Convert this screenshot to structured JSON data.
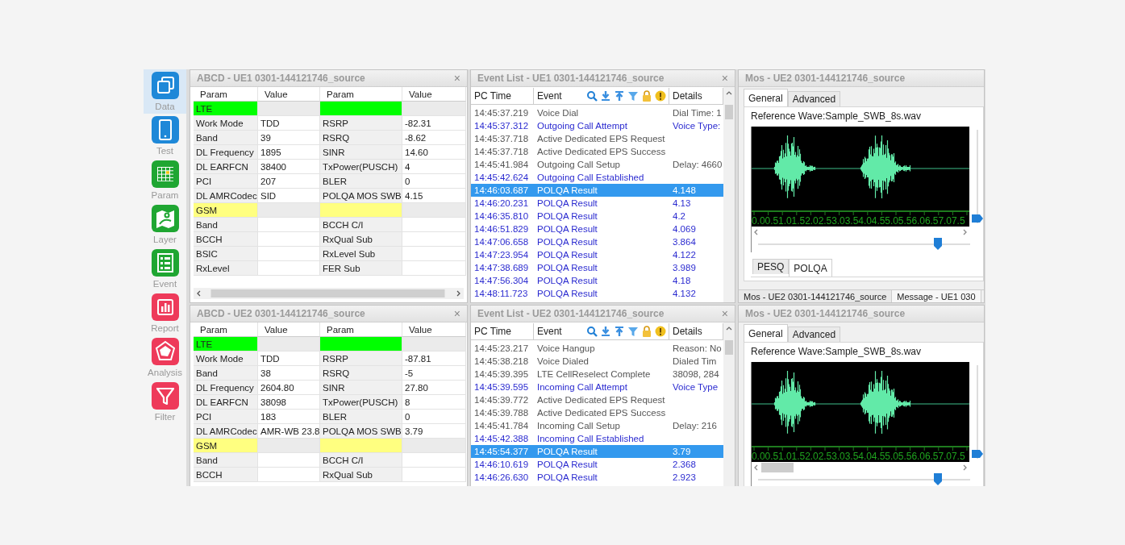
{
  "sidebar": {
    "items": [
      {
        "label": "Data",
        "selected": true,
        "color": "#1e88d8"
      },
      {
        "label": "Test",
        "selected": false,
        "color": "#1e88d8"
      },
      {
        "label": "Param",
        "selected": false,
        "color": "#1fa632"
      },
      {
        "label": "Layer",
        "selected": false,
        "color": "#1fa632"
      },
      {
        "label": "Event",
        "selected": false,
        "color": "#1fa632"
      },
      {
        "label": "Report",
        "selected": false,
        "color": "#ee3a5a"
      },
      {
        "label": "Analysis",
        "selected": false,
        "color": "#ee3a5a"
      },
      {
        "label": "Filter",
        "selected": false,
        "color": "#ee3a5a"
      }
    ]
  },
  "param_panels": [
    {
      "title": "ABCD - UE1 0301-144121746_source",
      "close": "×",
      "columns": [
        "Param",
        "Value",
        "Param",
        "Value"
      ],
      "horizontal_scrollbar": true,
      "rows": [
        {
          "kind": "section",
          "label": "LTE",
          "color": "#00ff00"
        },
        {
          "kind": "data",
          "param": "Work Mode",
          "value": "TDD",
          "param_2": "RSRP",
          "value_2": "-82.31"
        },
        {
          "kind": "data",
          "param": "Band",
          "value": "39",
          "param_2": "RSRQ",
          "value_2": "-8.62"
        },
        {
          "kind": "data",
          "param": "DL Frequency",
          "value": "1895",
          "param_2": "SINR",
          "value_2": "14.60"
        },
        {
          "kind": "data",
          "param": "DL EARFCN",
          "value": "38400",
          "param_2": "TxPower(PUSCH)",
          "value_2": "4"
        },
        {
          "kind": "data",
          "param": "PCI",
          "value": "207",
          "param_2": "BLER",
          "value_2": "0"
        },
        {
          "kind": "data",
          "param": "DL AMRCodec",
          "value": "SID",
          "param_2": "POLQA MOS SWB",
          "value_2": "4.15"
        },
        {
          "kind": "section",
          "label": "GSM",
          "color": "#ffff80"
        },
        {
          "kind": "data",
          "param": "Band",
          "param_2": "BCCH C/I"
        },
        {
          "kind": "data",
          "param": "BCCH",
          "param_2": "RxQual Sub"
        },
        {
          "kind": "data",
          "param": "BSIC",
          "param_2": "RxLevel Sub"
        },
        {
          "kind": "data",
          "param": "RxLevel",
          "param_2": "FER Sub"
        }
      ]
    },
    {
      "title": "ABCD - UE2 0301-144121746_source",
      "close": "×",
      "columns": [
        "Param",
        "Value",
        "Param",
        "Value"
      ],
      "rows": [
        {
          "kind": "section",
          "label": "LTE",
          "color": "#00ff00"
        },
        {
          "kind": "data",
          "param": "Work Mode",
          "value": "TDD",
          "param_2": "RSRP",
          "value_2": "-87.81"
        },
        {
          "kind": "data",
          "param": "Band",
          "value": "38",
          "param_2": "RSRQ",
          "value_2": "-5"
        },
        {
          "kind": "data",
          "param": "DL Frequency",
          "value": "2604.80",
          "param_2": "SINR",
          "value_2": "27.80"
        },
        {
          "kind": "data",
          "param": "DL EARFCN",
          "value": "38098",
          "param_2": "TxPower(PUSCH)",
          "value_2": "8"
        },
        {
          "kind": "data",
          "param": "PCI",
          "value": "183",
          "param_2": "BLER",
          "value_2": "0"
        },
        {
          "kind": "data",
          "param": "DL AMRCodec",
          "value": "AMR-WB 23.8",
          "param_2": "POLQA MOS SWB",
          "value_2": "3.79"
        },
        {
          "kind": "section",
          "label": "GSM",
          "color": "#ffff80"
        },
        {
          "kind": "data",
          "param": "Band",
          "param_2": "BCCH C/I"
        },
        {
          "kind": "data",
          "param": "BCCH",
          "param_2": "RxQual Sub"
        }
      ]
    }
  ],
  "event_panels": [
    {
      "title": "Event List - UE1 0301-144121746_source",
      "close": "×",
      "columns": [
        "PC Time",
        "Event",
        "Details"
      ],
      "rows": [
        {
          "time": "14:45:37.219",
          "event": "Voice Dial",
          "details": "Dial Time: 1",
          "color": "#555555",
          "selected": false
        },
        {
          "time": "14:45:37.312",
          "event": "Outgoing Call Attempt",
          "details": "Voice Type:",
          "color": "#2b2bd0",
          "selected": false
        },
        {
          "time": "14:45:37.718",
          "event": "Active Dedicated EPS Request",
          "color": "#555555",
          "selected": false
        },
        {
          "time": "14:45:37.718",
          "event": "Active Dedicated EPS Success",
          "color": "#555555",
          "selected": false
        },
        {
          "time": "14:45:41.984",
          "event": "Outgoing Call Setup",
          "details": "Delay: 4660",
          "color": "#555555",
          "selected": false
        },
        {
          "time": "14:45:42.624",
          "event": "Outgoing Call Established",
          "color": "#2b2bd0",
          "selected": false
        },
        {
          "time": "14:46:03.687",
          "event": "POLQA Result",
          "details": "4.148",
          "selected": true
        },
        {
          "time": "14:46:20.231",
          "event": "POLQA Result",
          "details": "4.13",
          "color": "#2b2bd0",
          "selected": false
        },
        {
          "time": "14:46:35.810",
          "event": "POLQA Result",
          "details": "4.2",
          "color": "#2b2bd0",
          "selected": false
        },
        {
          "time": "14:46:51.829",
          "event": "POLQA Result",
          "details": "4.069",
          "color": "#2b2bd0",
          "selected": false
        },
        {
          "time": "14:47:06.658",
          "event": "POLQA Result",
          "details": "3.864",
          "color": "#2b2bd0",
          "selected": false
        },
        {
          "time": "14:47:23.954",
          "event": "POLQA Result",
          "details": "4.122",
          "color": "#2b2bd0",
          "selected": false
        },
        {
          "time": "14:47:38.689",
          "event": "POLQA Result",
          "details": "3.989",
          "color": "#2b2bd0",
          "selected": false
        },
        {
          "time": "14:47:56.304",
          "event": "POLQA Result",
          "details": "4.18",
          "color": "#2b2bd0",
          "selected": false
        },
        {
          "time": "14:48:11.723",
          "event": "POLQA Result",
          "details": "4.132",
          "color": "#2b2bd0",
          "selected": false
        }
      ]
    },
    {
      "title": "Event List - UE2 0301-144121746_source",
      "close": "×",
      "columns": [
        "PC Time",
        "Event",
        "Details"
      ],
      "rows": [
        {
          "time": "14:45:23.217",
          "event": "Voice Hangup",
          "details": "Reason: No",
          "color": "#555555",
          "selected": false
        },
        {
          "time": "14:45:38.218",
          "event": "Voice Dialed",
          "details": "Dialed Tim",
          "color": "#555555",
          "selected": false
        },
        {
          "time": "14:45:39.395",
          "event": "LTE CellReselect Complete",
          "details": "38098, 284",
          "color": "#555555",
          "selected": false
        },
        {
          "time": "14:45:39.595",
          "event": "Incoming Call Attempt",
          "details": "Voice Type",
          "color": "#2b2bd0",
          "selected": false
        },
        {
          "time": "14:45:39.772",
          "event": "Active Dedicated EPS Request",
          "color": "#555555",
          "selected": false
        },
        {
          "time": "14:45:39.788",
          "event": "Active Dedicated EPS Success",
          "color": "#555555",
          "selected": false
        },
        {
          "time": "14:45:41.784",
          "event": "Incoming Call Setup",
          "details": "Delay: 216",
          "color": "#555555",
          "selected": false
        },
        {
          "time": "14:45:42.388",
          "event": "Incoming Call Established",
          "color": "#2b2bd0",
          "selected": false
        },
        {
          "time": "14:45:54.377",
          "event": "POLQA Result",
          "details": "3.79",
          "selected": true
        },
        {
          "time": "14:46:10.619",
          "event": "POLQA Result",
          "details": "2.368",
          "color": "#2b2bd0",
          "selected": false
        },
        {
          "time": "14:46:26.630",
          "event": "POLQA Result",
          "details": "2.923",
          "color": "#2b2bd0",
          "selected": false
        }
      ]
    }
  ],
  "mos_panels": [
    {
      "title": "Mos - UE2 0301-144121746_source",
      "tabs": [
        {
          "label": "General",
          "selected": true
        },
        {
          "label": "Advanced",
          "selected": false
        }
      ],
      "reference": "Reference Wave:Sample_SWB_8s.wav",
      "axis_labels": "0.00.51.01.52.02.53.03.54.04.55.05.56.06.57.07.5",
      "slider": {
        "level": 0.86
      },
      "vertical_slider": {
        "level": 0
      },
      "bottom_tabs": [
        {
          "label": "PESQ",
          "selected": false
        },
        {
          "label": "POLQA",
          "selected": true
        }
      ],
      "document_tabs": [
        {
          "label": "Mos - UE2 0301-144121746_source",
          "selected": true
        },
        {
          "label": "Message - UE1 030",
          "selected": false
        }
      ]
    },
    {
      "title": "Mos - UE2 0301-144121746_source",
      "tabs": [
        {
          "label": "General",
          "selected": true
        },
        {
          "label": "Advanced",
          "selected": false
        }
      ],
      "reference": "Reference Wave:Sample_SWB_8s.wav",
      "axis_labels": "0.00.51.01.52.02.53.03.54.04.55.05.56.06.57.07.5",
      "scrollbar_thumb": true,
      "slider": {
        "level": 0.86
      },
      "vertical_slider": {
        "level": 0
      }
    }
  ]
}
